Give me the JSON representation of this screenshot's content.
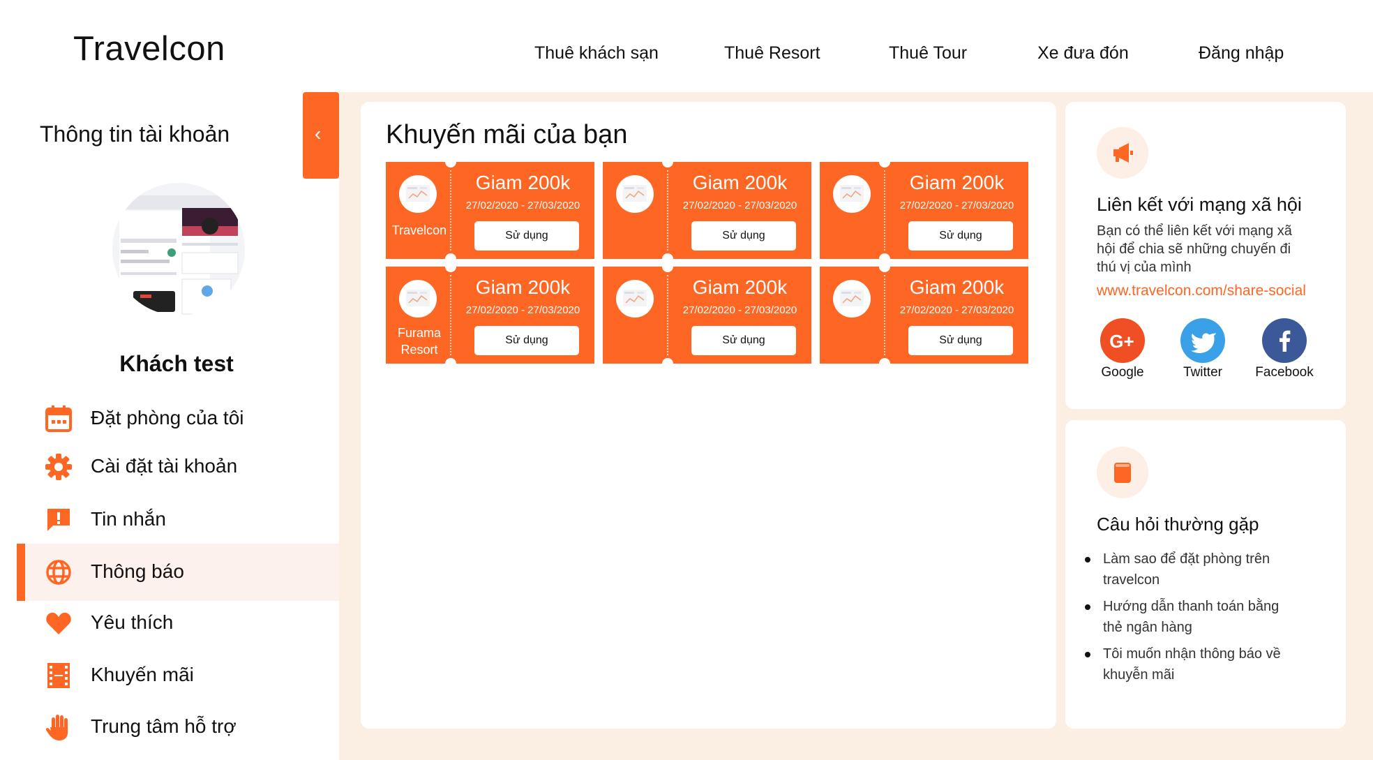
{
  "header": {
    "logo": "Travelcon",
    "nav": [
      "Thuê khách sạn",
      "Thuê Resort",
      "Thuê Tour",
      "Xe đưa đón",
      "Đăng nhập"
    ]
  },
  "sidebar": {
    "title": "Thông tin tài khoản",
    "user_name": "Khách test",
    "active_item": "Thông báo",
    "items": [
      {
        "label": "Đặt phòng của tôi",
        "icon": "calendar-icon"
      },
      {
        "label": "Cài đặt tài khoản",
        "icon": "gear-icon"
      },
      {
        "label": "Tin nhắn",
        "icon": "message-alert-icon"
      },
      {
        "label": "Thông báo",
        "icon": "globe-icon"
      },
      {
        "label": "Yêu thích",
        "icon": "heart-icon"
      },
      {
        "label": "Khuyến mãi",
        "icon": "film-icon"
      },
      {
        "label": "Trung tâm hỗ trợ",
        "icon": "hand-icon"
      }
    ]
  },
  "promotions": {
    "title": "Khuyến mãi của bạn",
    "coupons": [
      {
        "brand": "Travelcon",
        "amount": "Giam 200k",
        "date": "27/02/2020 - 27/03/2020",
        "button": "Sử dụng"
      },
      {
        "brand": "",
        "amount": "Giam 200k",
        "date": "27/02/2020 - 27/03/2020",
        "button": "Sử dụng"
      },
      {
        "brand": "",
        "amount": "Giam 200k",
        "date": "27/02/2020 - 27/03/2020",
        "button": "Sử dụng"
      },
      {
        "brand": "Furama Resort",
        "amount": "Giam 200k",
        "date": "27/02/2020 - 27/03/2020",
        "button": "Sử dụng"
      },
      {
        "brand": "",
        "amount": "Giam 200k",
        "date": "27/02/2020 - 27/03/2020",
        "button": "Sử dụng"
      },
      {
        "brand": "",
        "amount": "Giam 200k",
        "date": "27/02/2020 - 27/03/2020",
        "button": "Sử dụng"
      }
    ]
  },
  "social_panel": {
    "icon": "megaphone-icon",
    "title": "Liên kết với mạng xã hội",
    "description_lines": [
      "Bạn có thể liên kết với mạng xã",
      "hội để chia sẽ những chuyến đi",
      "thú vị của mình"
    ],
    "link": "www.travelcon.com/share-social",
    "networks": [
      {
        "name": "Google",
        "icon": "google-plus-icon",
        "color": "#f04e23"
      },
      {
        "name": "Twitter",
        "icon": "twitter-icon",
        "color": "#3aa1e8"
      },
      {
        "name": "Facebook",
        "icon": "facebook-icon",
        "color": "#3b5998"
      }
    ]
  },
  "faq_panel": {
    "icon": "book-icon",
    "title": "Câu hỏi thường gặp",
    "items": [
      {
        "line1": "Làm sao để đặt phòng trên",
        "line2": "travelcon"
      },
      {
        "line1": "Hướng dẫn thanh toán bằng",
        "line2": "thẻ ngân hàng"
      },
      {
        "line1": "Tôi muốn nhận thông báo về",
        "line2": "khuyễn mãi"
      }
    ]
  },
  "colors": {
    "accent": "#fe6624",
    "background": "#fbeee2",
    "panel": "#ffffff"
  }
}
